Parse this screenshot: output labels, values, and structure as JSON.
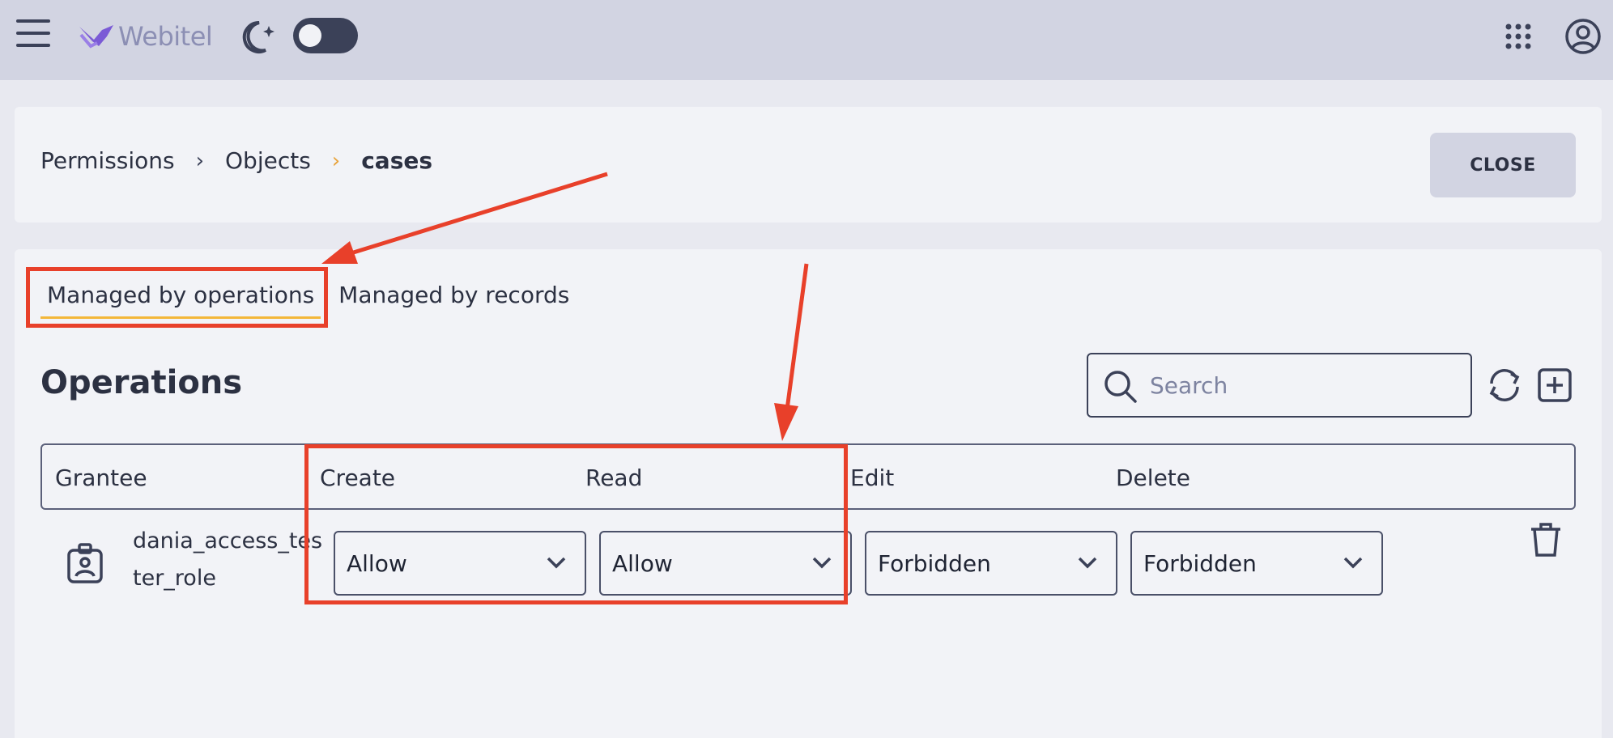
{
  "header": {
    "logo_text": "Webitel"
  },
  "breadcrumb": {
    "items": [
      "Permissions",
      "Objects"
    ],
    "separator": "›",
    "current": "cases"
  },
  "actions": {
    "close_label": "CLOSE"
  },
  "tabs": [
    {
      "label": "Managed by operations",
      "active": true
    },
    {
      "label": "Managed by records",
      "active": false
    }
  ],
  "section": {
    "title": "Operations"
  },
  "search": {
    "placeholder": "Search",
    "value": ""
  },
  "table": {
    "columns": [
      "Grantee",
      "Create",
      "Read",
      "Edit",
      "Delete"
    ],
    "rows": [
      {
        "grantee": "dania_access_tester_role",
        "create": "Allow",
        "read": "Allow",
        "edit": "Forbidden",
        "delete": "Forbidden"
      }
    ]
  },
  "icons": {
    "menu": "hamburger-icon",
    "theme": "moon-icon",
    "apps": "apps-grid-icon",
    "account": "account-icon",
    "search": "search-icon",
    "refresh": "refresh-icon",
    "add": "add-icon",
    "grantee": "role-badge-icon",
    "delete": "trash-icon",
    "dropdown": "chevron-down-icon"
  },
  "colors": {
    "topbar": "#d2d4e2",
    "surface": "#f2f3f7",
    "accent": "#f3b73a",
    "logo": "#7b5bd6",
    "annotation": "#e8402a"
  }
}
